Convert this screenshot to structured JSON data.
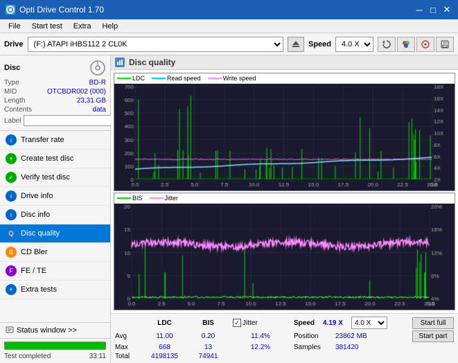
{
  "titleBar": {
    "title": "Opti Drive Control 1.70",
    "icon": "O",
    "minimizeLabel": "─",
    "maximizeLabel": "□",
    "closeLabel": "✕"
  },
  "menuBar": {
    "items": [
      "File",
      "Start test",
      "Extra",
      "Help"
    ]
  },
  "driveBar": {
    "driveLabel": "Drive",
    "driveValue": "(F:)  ATAPI iHBS112  2 CL0K",
    "speedLabel": "Speed",
    "speedValue": "4.0 X"
  },
  "sidebar": {
    "discTitle": "Disc",
    "discInfo": {
      "typeLabel": "Type",
      "typeValue": "BD-R",
      "midLabel": "MID",
      "midValue": "OTCBDR002 (000)",
      "lengthLabel": "Length",
      "lengthValue": "23,31 GB",
      "contentsLabel": "Contents",
      "contentsValue": "data",
      "labelLabel": "Label",
      "labelValue": ""
    },
    "navItems": [
      {
        "id": "transfer-rate",
        "label": "Transfer rate",
        "iconColor": "blue"
      },
      {
        "id": "create-test-disc",
        "label": "Create test disc",
        "iconColor": "green"
      },
      {
        "id": "verify-test-disc",
        "label": "Verify test disc",
        "iconColor": "green"
      },
      {
        "id": "drive-info",
        "label": "Drive info",
        "iconColor": "blue"
      },
      {
        "id": "disc-info",
        "label": "Disc info",
        "iconColor": "blue"
      },
      {
        "id": "disc-quality",
        "label": "Disc quality",
        "iconColor": "blue",
        "active": true
      },
      {
        "id": "cd-bler",
        "label": "CD Bler",
        "iconColor": "orange"
      },
      {
        "id": "fe-te",
        "label": "FE / TE",
        "iconColor": "purple"
      },
      {
        "id": "extra-tests",
        "label": "Extra tests",
        "iconColor": "blue"
      }
    ],
    "statusWindowLabel": "Status window >>",
    "progressPercent": 100,
    "progressText": "Test completed",
    "timeText": "33:11"
  },
  "chartPanel": {
    "title": "Disc quality",
    "topChart": {
      "title": "LDC / Read speed / Write speed",
      "legend": [
        {
          "label": "LDC",
          "color": "#00aa00"
        },
        {
          "label": "Read speed",
          "color": "#00ccff"
        },
        {
          "label": "Write speed",
          "color": "#ff88ff"
        }
      ],
      "yAxisMax": 700,
      "yAxisRight": [
        "18X",
        "16X",
        "14X",
        "12X",
        "10X",
        "8X",
        "6X",
        "4X",
        "2X"
      ],
      "xAxisMax": 25
    },
    "bottomChart": {
      "title": "BIS / Jitter",
      "legend": [
        {
          "label": "BIS",
          "color": "#00aa00"
        },
        {
          "label": "Jitter",
          "color": "#ff88ff"
        }
      ],
      "yAxisMax": 20,
      "yAxisRight": [
        "20%",
        "16%",
        "12%",
        "8%",
        "4%"
      ],
      "xAxisMax": 25
    },
    "stats": {
      "columns": [
        "",
        "LDC",
        "BIS",
        "",
        "Jitter",
        "Speed",
        ""
      ],
      "rows": [
        {
          "label": "Avg",
          "ldc": "11.00",
          "bis": "0.20",
          "jitter": "11.4%",
          "speed": "4.19 X"
        },
        {
          "label": "Max",
          "ldc": "668",
          "bis": "13",
          "jitter": "12.2%",
          "position": "23862 MB"
        },
        {
          "label": "Total",
          "ldc": "4198135",
          "bis": "74941",
          "samples": "381420"
        }
      ],
      "speedDropdownValue": "4.0 X",
      "startFullLabel": "Start full",
      "startPartLabel": "Start part"
    }
  }
}
